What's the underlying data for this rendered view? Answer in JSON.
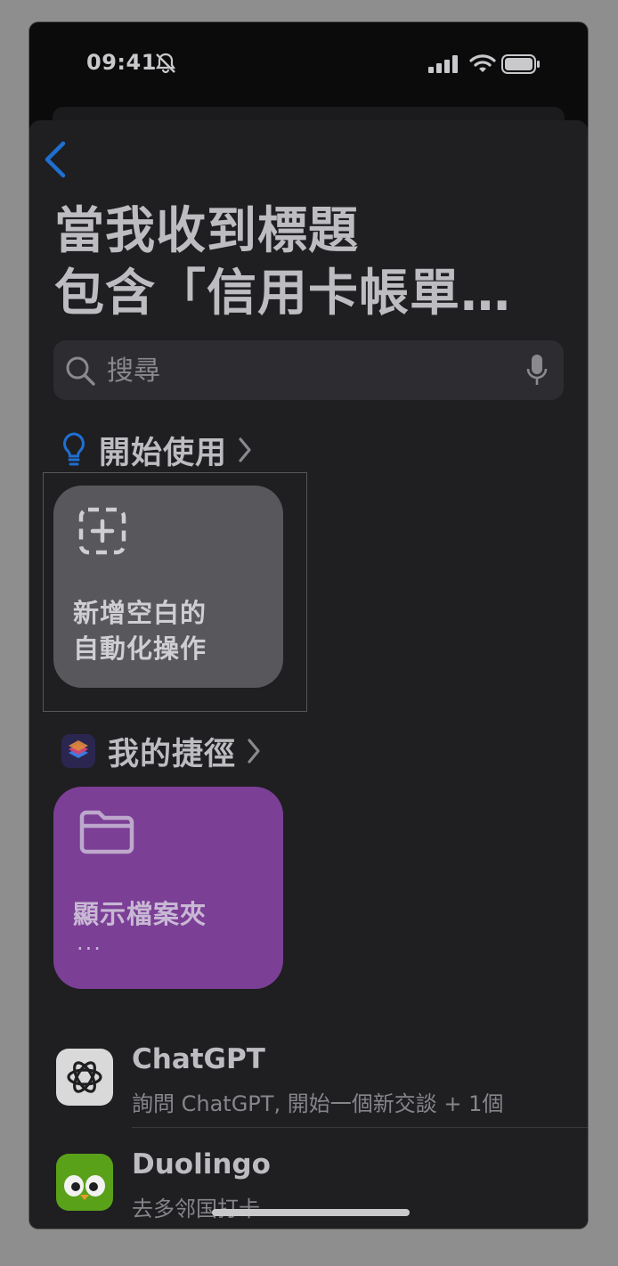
{
  "status_bar": {
    "time": "09:41"
  },
  "header": {
    "title": "當我收到標題\n包含「信用卡帳單…"
  },
  "search": {
    "placeholder": "搜尋"
  },
  "sections": {
    "get_started": {
      "title": "開始使用",
      "tile_label": "新增空白的\n自動化操作"
    },
    "my_shortcuts": {
      "title": "我的捷徑",
      "tile_label": "顯示檔案夾",
      "tile_more": "···"
    }
  },
  "apps": [
    {
      "name": "ChatGPT",
      "subtitle": "詢問 ChatGPT, 開始一個新交談 + 1個"
    },
    {
      "name": "Duolingo",
      "subtitle": "去多邻国打卡"
    }
  ],
  "colors": {
    "accent": "#1f6fd1",
    "tile_gray": "#58585c",
    "tile_purple": "#7b3f96",
    "duolingo_green": "#5aa11a"
  }
}
